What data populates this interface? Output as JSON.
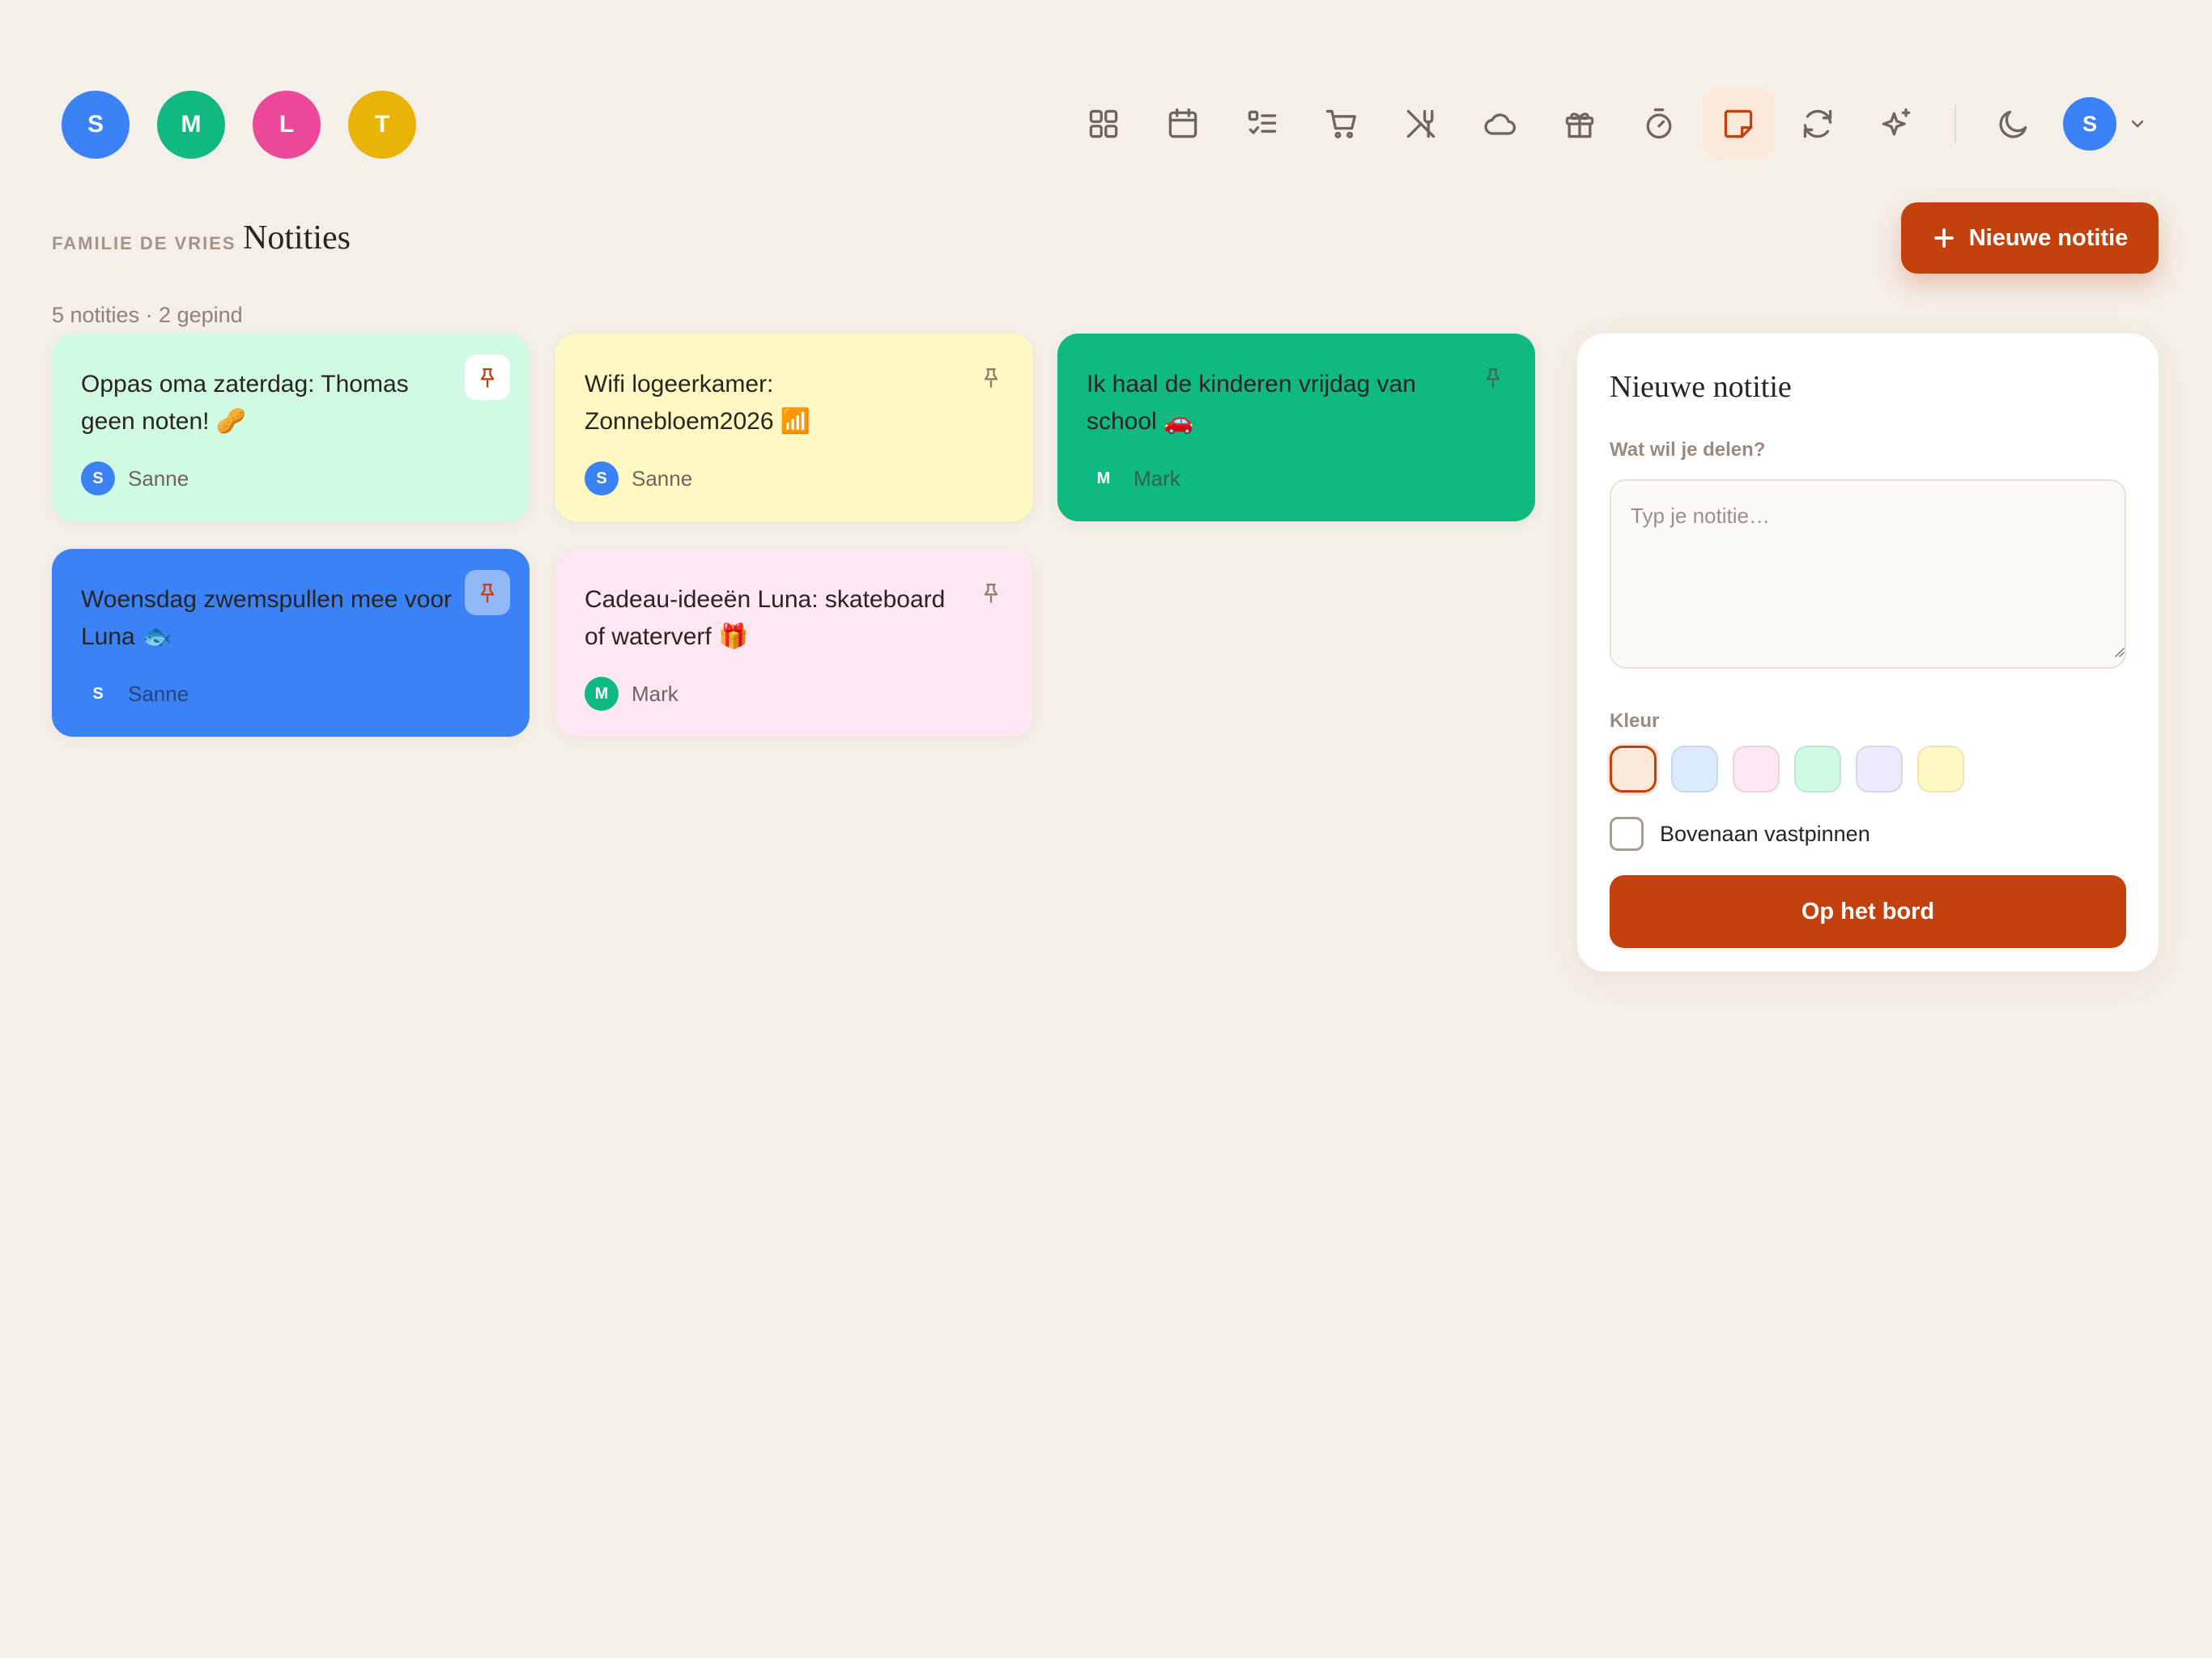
{
  "members": [
    {
      "initial": "S",
      "color": "#3b82f6"
    },
    {
      "initial": "M",
      "color": "#10b981"
    },
    {
      "initial": "L",
      "color": "#ec4899"
    },
    {
      "initial": "T",
      "color": "#eab308"
    }
  ],
  "nav": {
    "icons": [
      "grid-icon",
      "calendar-icon",
      "checklist-icon",
      "cart-icon",
      "utensils-icon",
      "cloud-icon",
      "gift-icon",
      "timer-icon",
      "note-icon",
      "refresh-icon",
      "sparkles-icon",
      "moon-icon"
    ],
    "active": "note-icon"
  },
  "user": {
    "initial": "S",
    "color": "#3b82f6"
  },
  "header": {
    "family": "FAMILIE DE VRIES",
    "title": "Notities",
    "new_button": "Nieuwe notitie",
    "summary": "5 notities · 2 gepind"
  },
  "notes": [
    {
      "text": "Oppas oma zaterdag: Thomas geen noten! 🥜",
      "author": "Sanne",
      "initial": "S",
      "avatar_color": "#3b82f6",
      "bg": "#d1fae5",
      "pinned": true
    },
    {
      "text": "Wifi logeerkamer: Zonnebloem2026 📶",
      "author": "Sanne",
      "initial": "S",
      "avatar_color": "#3b82f6",
      "bg": "#fef9c3",
      "pinned": false
    },
    {
      "text": "Ik haal de kinderen vrijdag van school 🚗",
      "author": "Mark",
      "initial": "M",
      "avatar_color": "#10b981",
      "bg": "#10b981",
      "pinned": false
    },
    {
      "text": "Woensdag zwemspullen mee voor Luna 🐟",
      "author": "Sanne",
      "initial": "S",
      "avatar_color": "#3b82f6",
      "bg": "#3b82f6",
      "pinned": true
    },
    {
      "text": "Cadeau-ideeën Luna: skateboard of waterverf 🎁",
      "author": "Mark",
      "initial": "M",
      "avatar_color": "#10b981",
      "bg": "#fce7f3",
      "pinned": false
    }
  ],
  "composer": {
    "title": "Nieuwe notitie",
    "prompt_label": "Wat wil je delen?",
    "placeholder": "Typ je notitie…",
    "color_label": "Kleur",
    "colors": [
      "#fde9d9",
      "#dbeafe",
      "#fce7f3",
      "#d1fae5",
      "#ede9fe",
      "#fef9c3"
    ],
    "selected_color": "#fde9d9",
    "pin_label": "Bovenaan vastpinnen",
    "pin_checked": false,
    "submit": "Op het bord"
  }
}
